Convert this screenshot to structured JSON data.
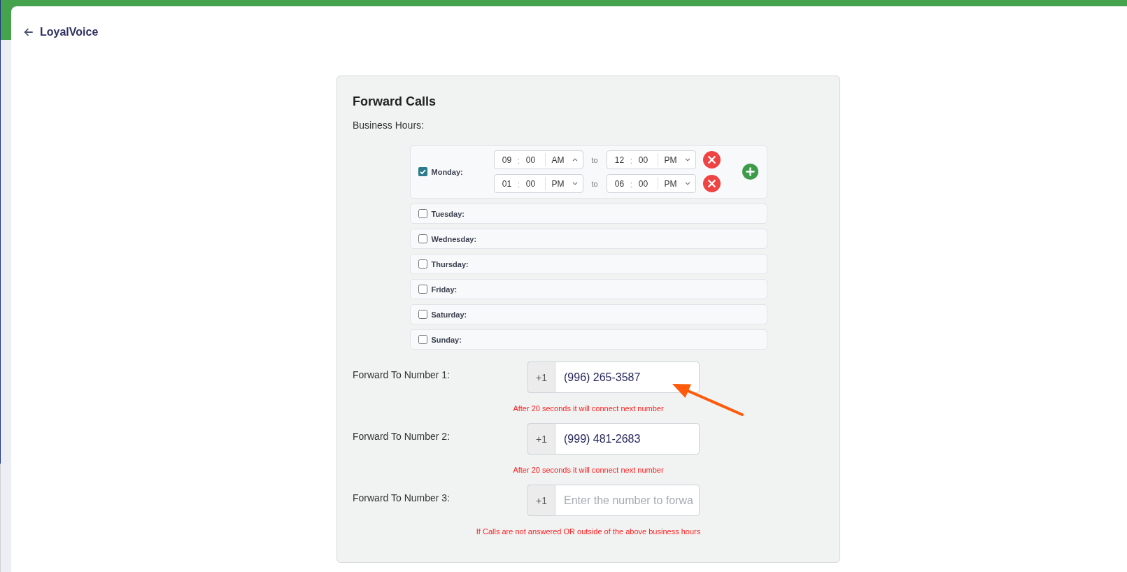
{
  "header": {
    "title": "LoyalVoice"
  },
  "forward_calls": {
    "title": "Forward Calls",
    "business_hours_label": "Business Hours:",
    "days": [
      {
        "label": "Monday:",
        "checked": true,
        "add_button": true,
        "ranges": [
          {
            "start": {
              "hour": "09",
              "separator": ":",
              "minute": "00",
              "period": "AM",
              "expanded": true
            },
            "to_label": "to",
            "end": {
              "hour": "12",
              "separator": ":",
              "minute": "00",
              "period": "PM",
              "expanded": false
            }
          },
          {
            "start": {
              "hour": "01",
              "separator": ":",
              "minute": "00",
              "period": "PM",
              "expanded": false
            },
            "to_label": "to",
            "end": {
              "hour": "06",
              "separator": ":",
              "minute": "00",
              "period": "PM",
              "expanded": false
            }
          }
        ]
      },
      {
        "label": "Tuesday:",
        "checked": false,
        "add_button": false
      },
      {
        "label": "Wednesday:",
        "checked": false,
        "add_button": false
      },
      {
        "label": "Thursday:",
        "checked": false,
        "add_button": false
      },
      {
        "label": "Friday:",
        "checked": false,
        "add_button": false
      },
      {
        "label": "Saturday:",
        "checked": false,
        "add_button": false
      },
      {
        "label": "Sunday:",
        "checked": false,
        "add_button": false
      }
    ],
    "numbers": [
      {
        "label": "Forward To Number 1:",
        "prefix": "+1",
        "value": "(996) 265-3587",
        "hint": "After 20 seconds it will connect next number"
      },
      {
        "label": "Forward To Number 2:",
        "prefix": "+1",
        "value": "(999) 481-2683",
        "hint": "After 20 seconds it will connect next number"
      },
      {
        "label": "Forward To Number 3:",
        "prefix": "+1",
        "placeholder": "Enter the number to forwa",
        "hint": "If Calls are not answered OR outside of the above business hours"
      }
    ]
  }
}
